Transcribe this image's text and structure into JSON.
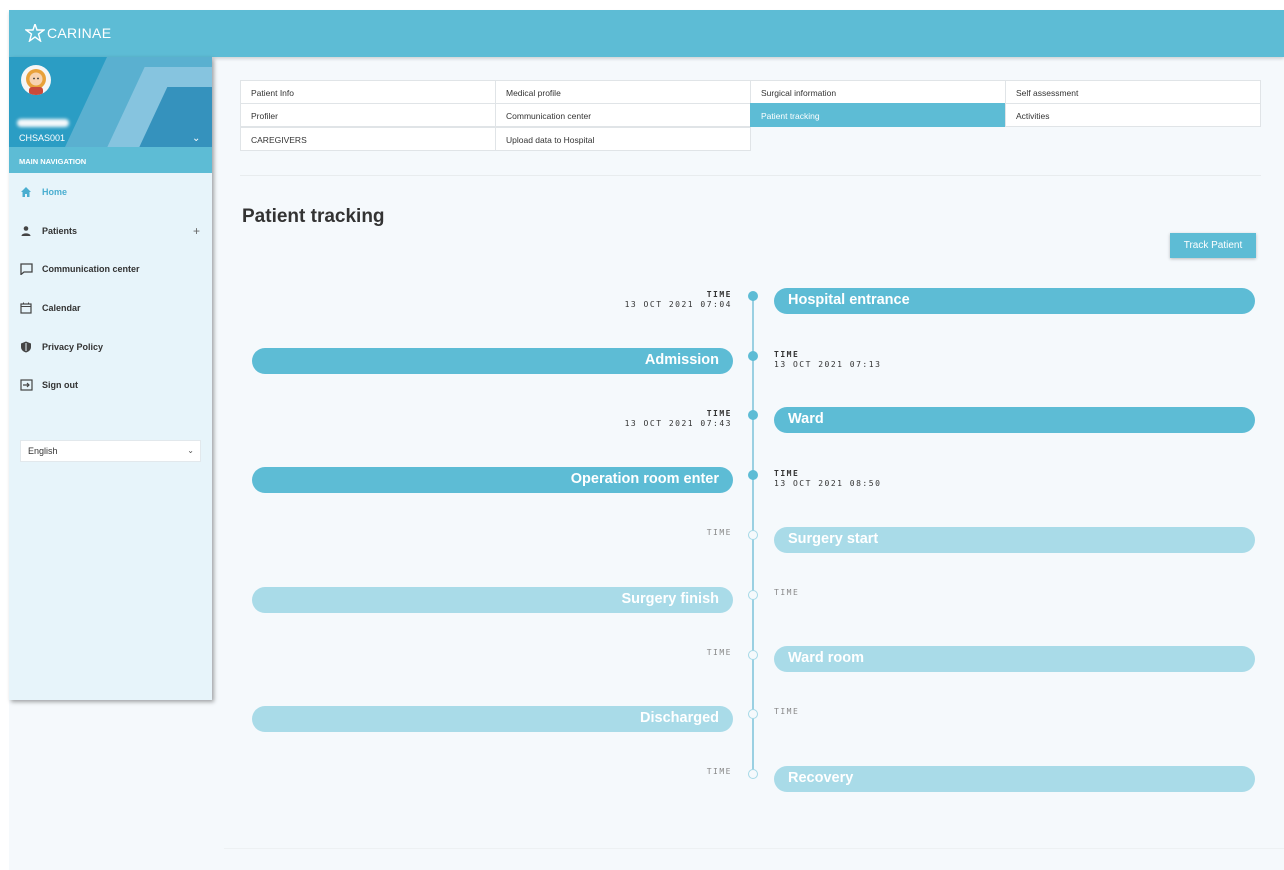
{
  "brand": {
    "name": "CARINAE"
  },
  "sidebar": {
    "user_id": "CHSAS001",
    "nav_title": "MAIN NAVIGATION",
    "items": [
      {
        "label": "Home",
        "icon": "home-icon"
      },
      {
        "label": "Patients",
        "icon": "person-icon",
        "expand": "+"
      },
      {
        "label": "Communication center",
        "icon": "chat-icon"
      },
      {
        "label": "Calendar",
        "icon": "calendar-icon"
      },
      {
        "label": "Privacy Policy",
        "icon": "shield-icon"
      },
      {
        "label": "Sign out",
        "icon": "sign-out-icon"
      }
    ],
    "language": "English"
  },
  "tabs": [
    "Patient Info",
    "Medical profile",
    "Surgical information",
    "Self assessment",
    "Profiler",
    "Communication center",
    "Patient tracking",
    "Activities",
    "CAREGIVERS",
    "Upload data to Hospital"
  ],
  "active_tab": "Patient tracking",
  "page": {
    "title": "Patient tracking",
    "track_button": "Track Patient"
  },
  "timeline": [
    {
      "label": "Hospital entrance",
      "time_label": "TIME",
      "time": "13 OCT 2021 07:04",
      "status": "done"
    },
    {
      "label": "Admission",
      "time_label": "TIME",
      "time": "13 OCT 2021 07:13",
      "status": "done"
    },
    {
      "label": "Ward",
      "time_label": "TIME",
      "time": "13 OCT 2021 07:43",
      "status": "done"
    },
    {
      "label": "Operation room enter",
      "time_label": "TIME",
      "time": "13 OCT 2021 08:50",
      "status": "done"
    },
    {
      "label": "Surgery start",
      "time_label": "TIME",
      "time": "",
      "status": "pending"
    },
    {
      "label": "Surgery finish",
      "time_label": "TIME",
      "time": "",
      "status": "pending"
    },
    {
      "label": "Ward room",
      "time_label": "TIME",
      "time": "",
      "status": "pending"
    },
    {
      "label": "Discharged",
      "time_label": "TIME",
      "time": "",
      "status": "pending"
    },
    {
      "label": "Recovery",
      "time_label": "TIME",
      "time": "",
      "status": "pending"
    }
  ],
  "colors": {
    "accent": "#5dbcd5",
    "pending": "#a9dbe8",
    "sidebar_bg": "#e7f4fa"
  }
}
